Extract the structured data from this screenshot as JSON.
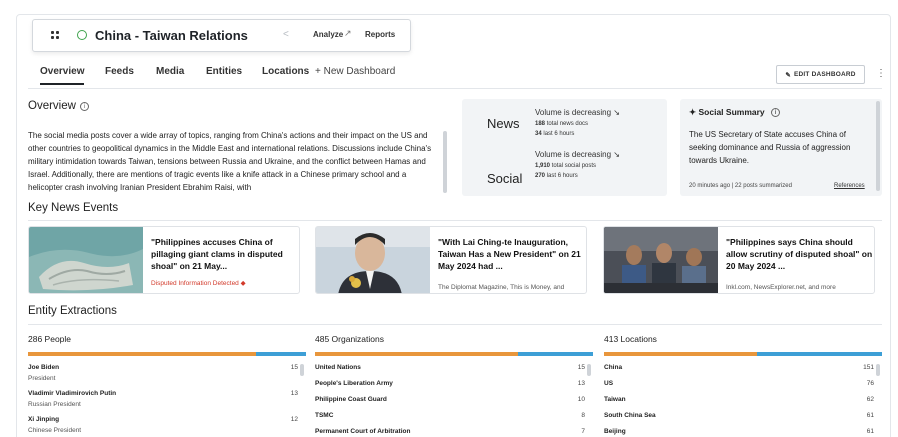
{
  "header": {
    "title": "China - Taiwan Relations",
    "analyze_label": "Analyze",
    "reports_label": "Reports"
  },
  "tabs": [
    {
      "label": "Overview",
      "active": true
    },
    {
      "label": "Feeds"
    },
    {
      "label": "Media"
    },
    {
      "label": "Entities"
    },
    {
      "label": "Locations"
    }
  ],
  "new_dashboard_label": "+ New Dashboard",
  "edit_dashboard_label": "EDIT DASHBOARD",
  "overview": {
    "title": "Overview",
    "text": "The social media posts cover a wide array of topics, ranging from China's actions and their impact on the US and other countries to geopolitical dynamics in the Middle East and international relations. Discussions include China's military intimidation towards Taiwan, tensions between Russia and Ukraine, and the conflict between Hamas and Israel. Additionally, there are mentions of tragic events like a knife attack in a Chinese primary school and a helicopter crash involving Iranian President Ebrahim Raisi, with"
  },
  "stats": {
    "news": {
      "label": "News",
      "trend": "Volume is decreasing",
      "total": "188",
      "total_label": "total news docs",
      "recent": "34",
      "recent_label": "last 6 hours"
    },
    "social": {
      "label": "Social",
      "trend": "Volume is decreasing",
      "total": "1,910",
      "total_label": "total social posts",
      "recent": "270",
      "recent_label": "last 6 hours"
    }
  },
  "summary": {
    "title": "Social Summary",
    "text": "The US Secretary of State accuses China of seeking dominance and Russia of aggression towards Ukraine.",
    "meta": "20 minutes ago | 22 posts summarized",
    "references_label": "References"
  },
  "key_news": {
    "title": "Key News Events",
    "items": [
      {
        "headline": "\"Philippines accuses China of pillaging giant clams in disputed shoal\" on 21 May...",
        "warning": "Disputed Information Detected"
      },
      {
        "headline": "\"With Lai Ching-te Inauguration, Taiwan Has a New President\" on 21 May 2024 had ...",
        "source": "The Diplomat Magazine, This is Money, and"
      },
      {
        "headline": "\"Philippines says China should allow scrutiny of disputed shoal\" on 20 May 2024 ...",
        "source": "Inkl.com, NewsExplorer.net, and more"
      }
    ]
  },
  "entities": {
    "title": "Entity Extractions",
    "colors": {
      "primary": "#e8963c",
      "secondary": "#3d9fd6"
    },
    "people": {
      "header": "286 People",
      "split": 0.82,
      "rows": [
        {
          "name": "Joe Biden",
          "sub": "President",
          "count": "15"
        },
        {
          "name": "Vladimir Vladimirovich Putin",
          "sub": "Russian President",
          "count": "13"
        },
        {
          "name": "Xi Jinping",
          "sub": "Chinese President",
          "count": "12"
        }
      ]
    },
    "organizations": {
      "header": "485 Organizations",
      "split": 0.73,
      "rows": [
        {
          "name": "United Nations",
          "count": "15"
        },
        {
          "name": "People's Liberation Army",
          "count": "13"
        },
        {
          "name": "Philippine Coast Guard",
          "count": "10"
        },
        {
          "name": "TSMC",
          "count": "8"
        },
        {
          "name": "Permanent Court of Arbitration",
          "count": "7"
        }
      ]
    },
    "locations": {
      "header": "413 Locations",
      "split": 0.55,
      "rows": [
        {
          "name": "China",
          "count": "151"
        },
        {
          "name": "US",
          "count": "76"
        },
        {
          "name": "Taiwan",
          "count": "62"
        },
        {
          "name": "South China Sea",
          "count": "61"
        },
        {
          "name": "Beijing",
          "count": "61"
        }
      ]
    }
  }
}
